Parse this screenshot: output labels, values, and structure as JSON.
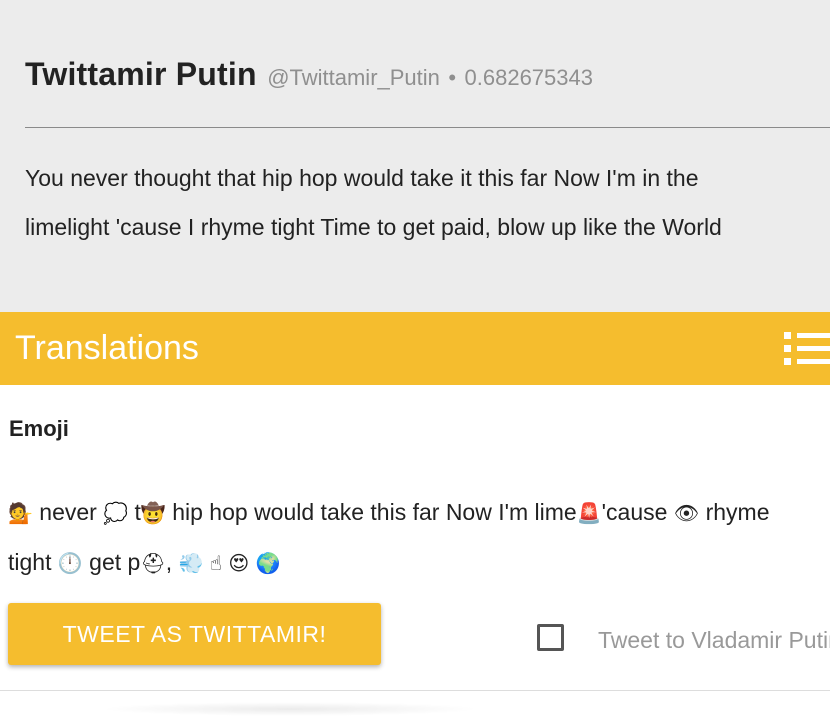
{
  "tweet": {
    "author_name": "Twittamir Putin",
    "handle": "@Twittamir_Putin",
    "separator": "•",
    "score": "0.682675343",
    "text_line1": "You never thought that hip hop would take it this far Now I'm in the",
    "text_line2": "limelight 'cause I rhyme tight Time to get paid, blow up like the World"
  },
  "translations": {
    "title": "Translations",
    "menu_icon": "list-icon",
    "section_label": "Emoji",
    "emoji_line": {
      "e1": "💁",
      "t1": " never ",
      "e2": "💭",
      "t2": " t",
      "e3": "🤠",
      "t3": " hip hop would take this far Now I'm lime",
      "e4": "🚨",
      "t4": "'cause ",
      "e5": "👁",
      "t5": " rhyme"
    },
    "emoji_line2": {
      "t1": "tight ",
      "e1": "🕛",
      "t2": " get p",
      "e2": "⛑",
      "t3": ", ",
      "e3": "💨",
      "t4": " ",
      "e4": "☝",
      "t5": " ",
      "e5": "😍",
      "t6": " ",
      "e6": "🌍"
    }
  },
  "actions": {
    "tweet_button": "TWEET AS TWITTAMIR!",
    "checkbox_label": "Tweet to Vladamir Putin",
    "checkbox_checked": false
  },
  "colors": {
    "accent": "#f5bd2e",
    "card_bg": "#ececec",
    "muted": "#8f8f8f"
  }
}
